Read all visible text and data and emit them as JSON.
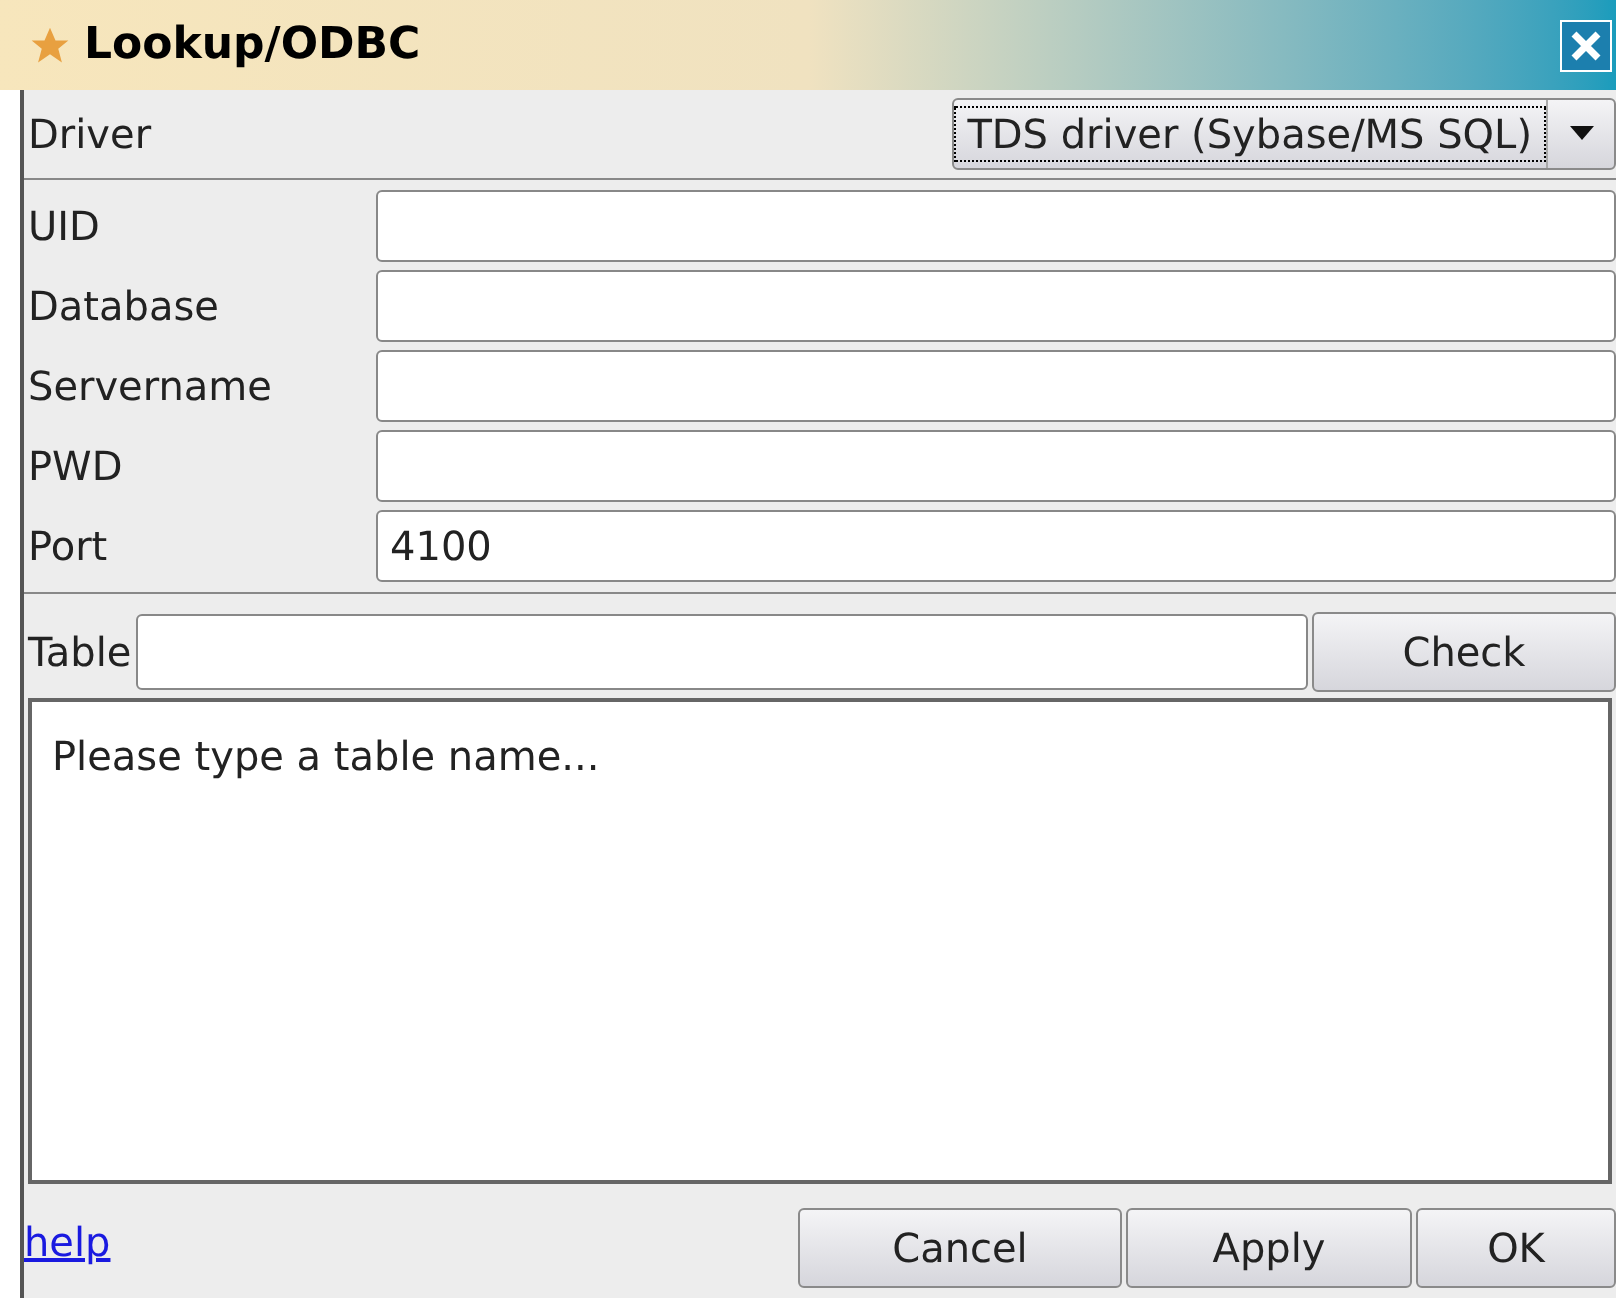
{
  "window": {
    "title": "Lookup/ODBC"
  },
  "driver": {
    "label": "Driver",
    "value": "TDS driver (Sybase/MS SQL)"
  },
  "fields": [
    {
      "label": "UID"
    },
    {
      "label": "Database"
    },
    {
      "label": "Servername"
    },
    {
      "label": "PWD"
    },
    {
      "label": "Port",
      "value": "4100"
    }
  ],
  "table": {
    "label": "Table",
    "button": "Check"
  },
  "message": "Please type a table name...",
  "footer": {
    "link": "help",
    "buttons": [
      "Cancel",
      "Apply",
      "OK"
    ]
  }
}
